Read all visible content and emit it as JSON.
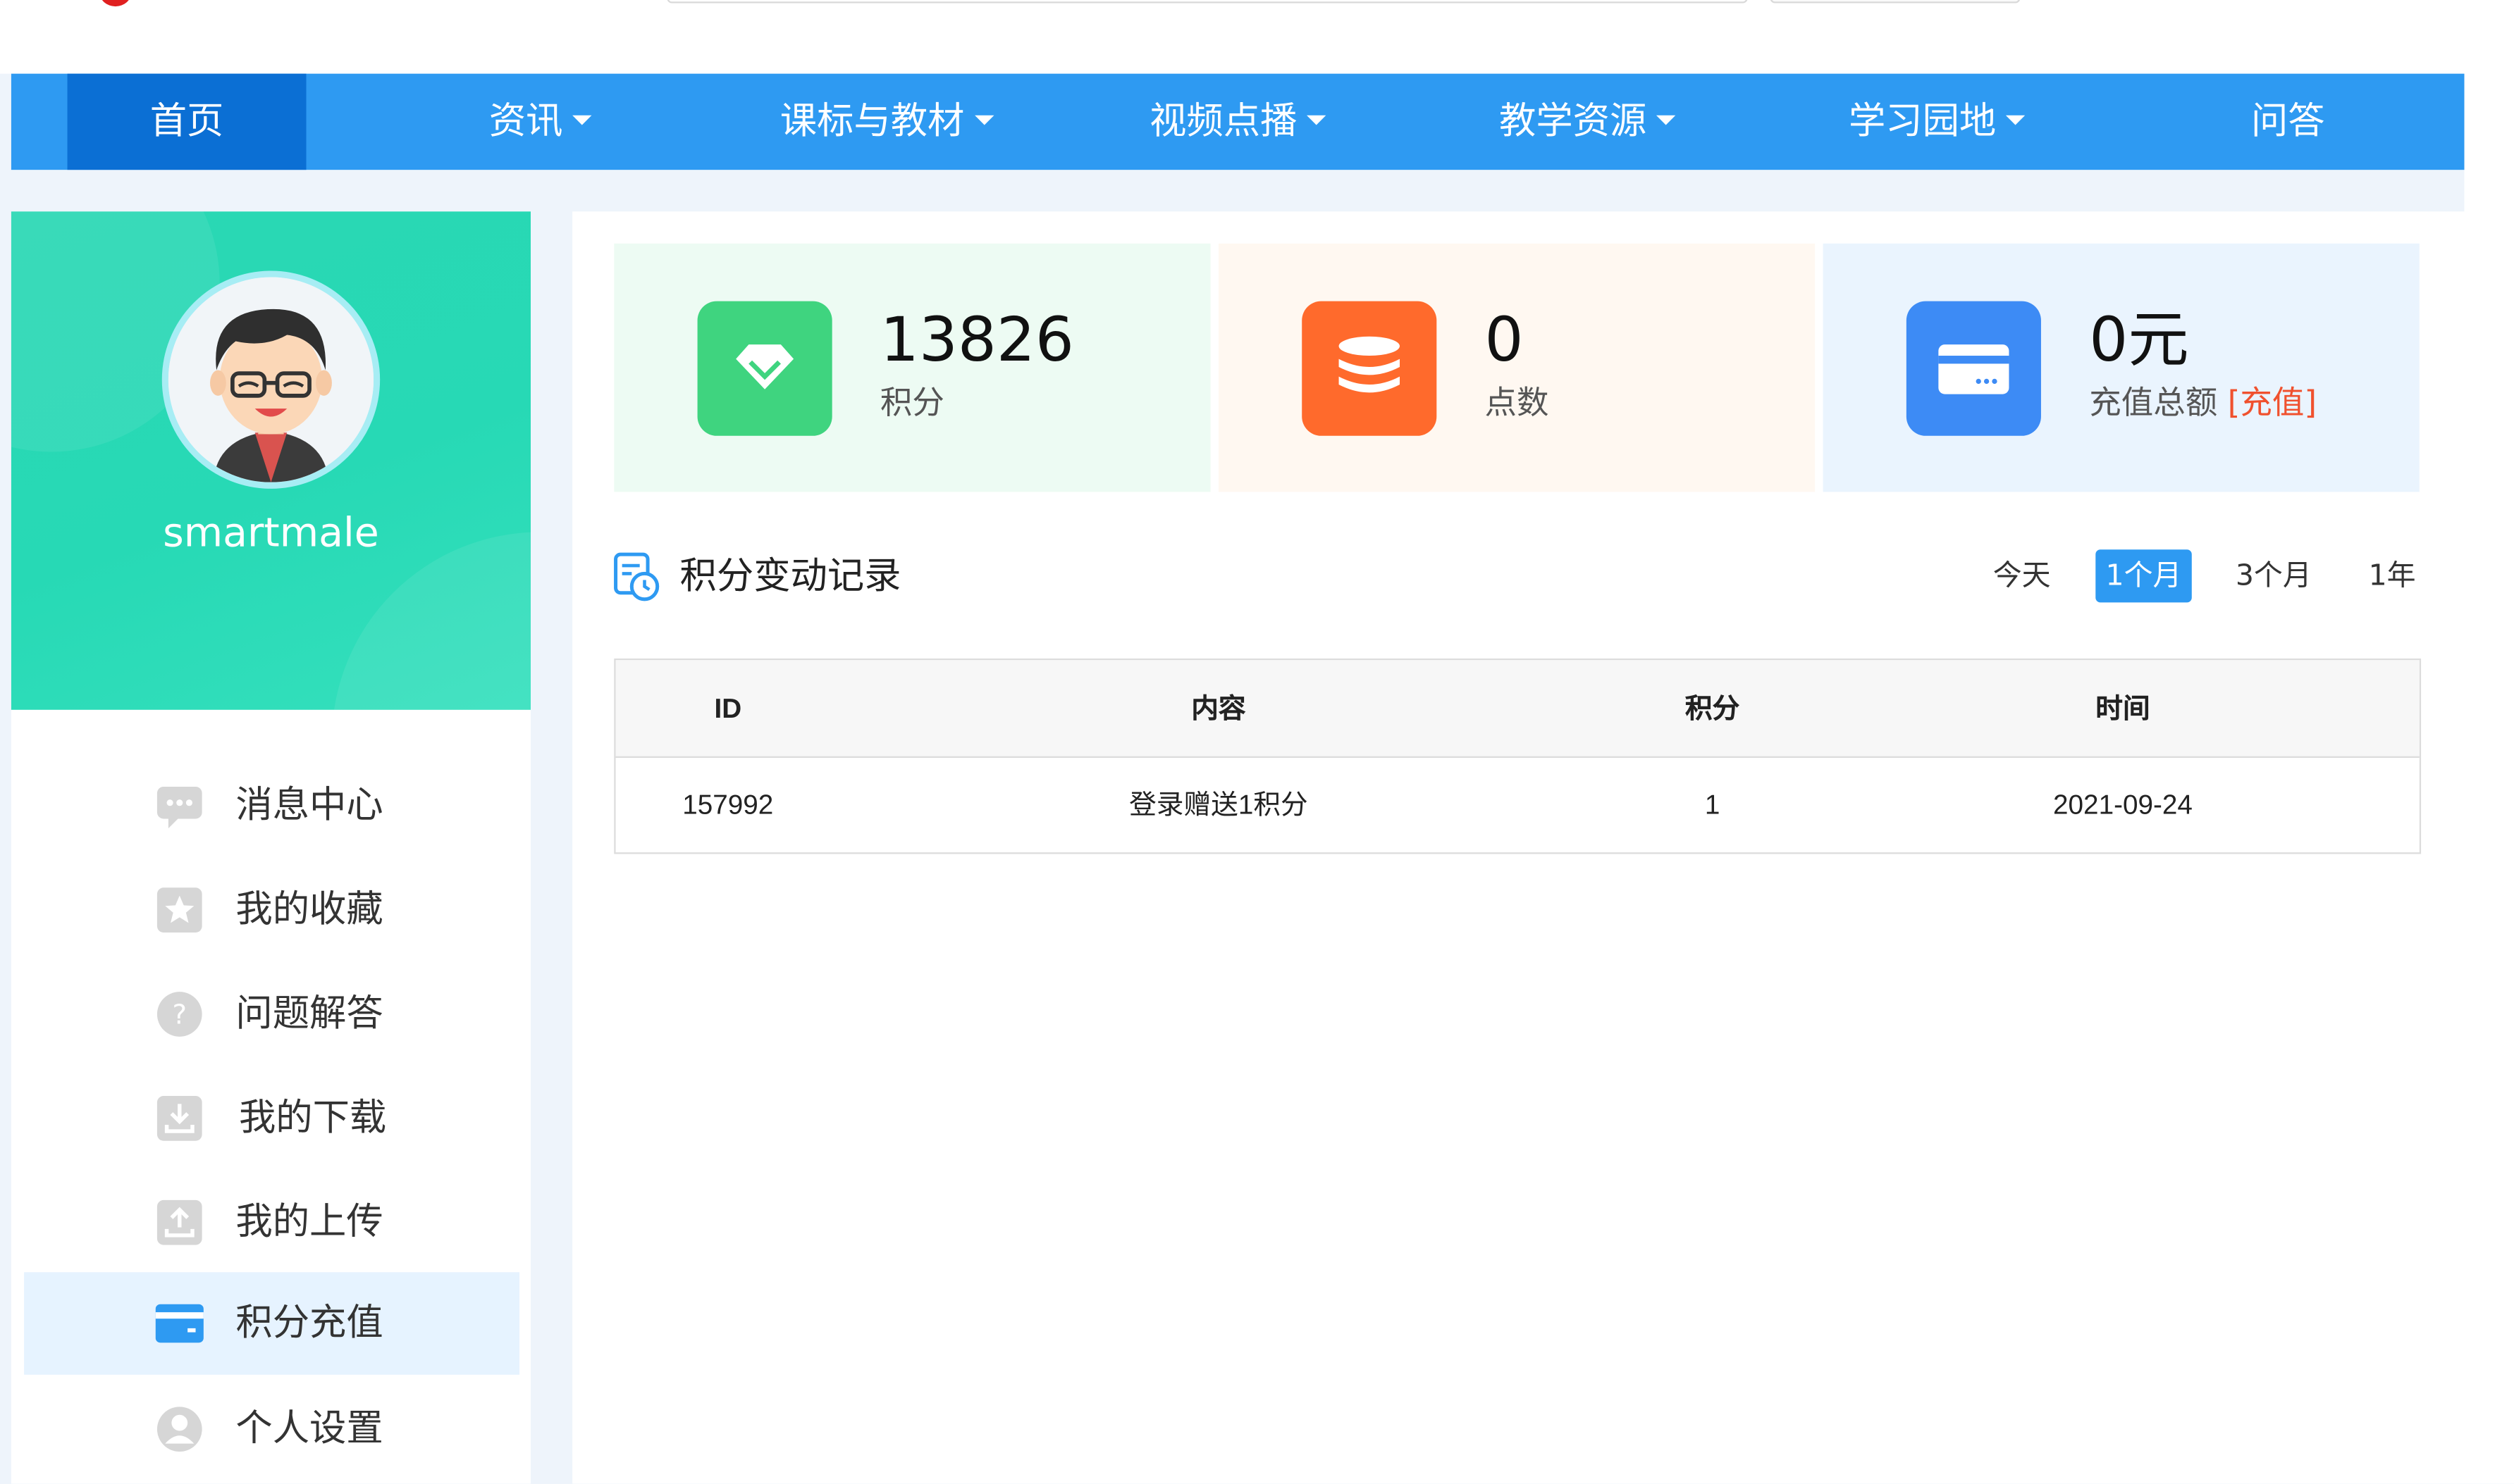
{
  "nav": {
    "items": [
      {
        "label": "首页",
        "active": true
      },
      {
        "label": "资讯",
        "dropdown": true
      },
      {
        "label": "课标与教材",
        "dropdown": true
      },
      {
        "label": "视频点播",
        "dropdown": true
      },
      {
        "label": "教学资源",
        "dropdown": true
      },
      {
        "label": "学习园地",
        "dropdown": true
      },
      {
        "label": "问答"
      }
    ]
  },
  "profile": {
    "username": "smartmale"
  },
  "sidebar": {
    "items": [
      {
        "label": "消息中心",
        "icon": "message-icon"
      },
      {
        "label": "我的收藏",
        "icon": "star-icon"
      },
      {
        "label": "问题解答",
        "icon": "question-icon"
      },
      {
        "label": "我的下载",
        "icon": "download-icon"
      },
      {
        "label": "我的上传",
        "icon": "upload-icon"
      },
      {
        "label": "积分充值",
        "icon": "wallet-icon",
        "active": true
      },
      {
        "label": "个人设置",
        "icon": "user-icon"
      }
    ]
  },
  "stats": [
    {
      "value": "13826",
      "label": "积分",
      "icon": "diamond-icon",
      "color": "#3fd47f",
      "bg": "#edfbf3"
    },
    {
      "value": "0",
      "label": "点数",
      "icon": "coins-icon",
      "color": "#ff6a2c",
      "bg": "#fff8f1"
    },
    {
      "value": "0元",
      "label": "充值总额",
      "link": "[充值]",
      "icon": "card-icon",
      "color": "#3d8bf5",
      "bg": "#eaf4fe"
    }
  ],
  "records": {
    "title": "积分变动记录",
    "filters": [
      {
        "label": "今天"
      },
      {
        "label": "1个月",
        "active": true
      },
      {
        "label": "3个月"
      },
      {
        "label": "1年"
      }
    ],
    "columns": [
      "ID",
      "内容",
      "积分",
      "时间"
    ],
    "rows": [
      [
        "157992",
        "登录赠送1积分",
        "1",
        "2021-09-24"
      ]
    ]
  },
  "colors": {
    "nav_bg": "#2e9af2",
    "nav_active": "#0b6fd4",
    "profile_bg": "#2ad8b4",
    "accent_link": "#f0512e",
    "page_bg": "#eef4fb"
  }
}
